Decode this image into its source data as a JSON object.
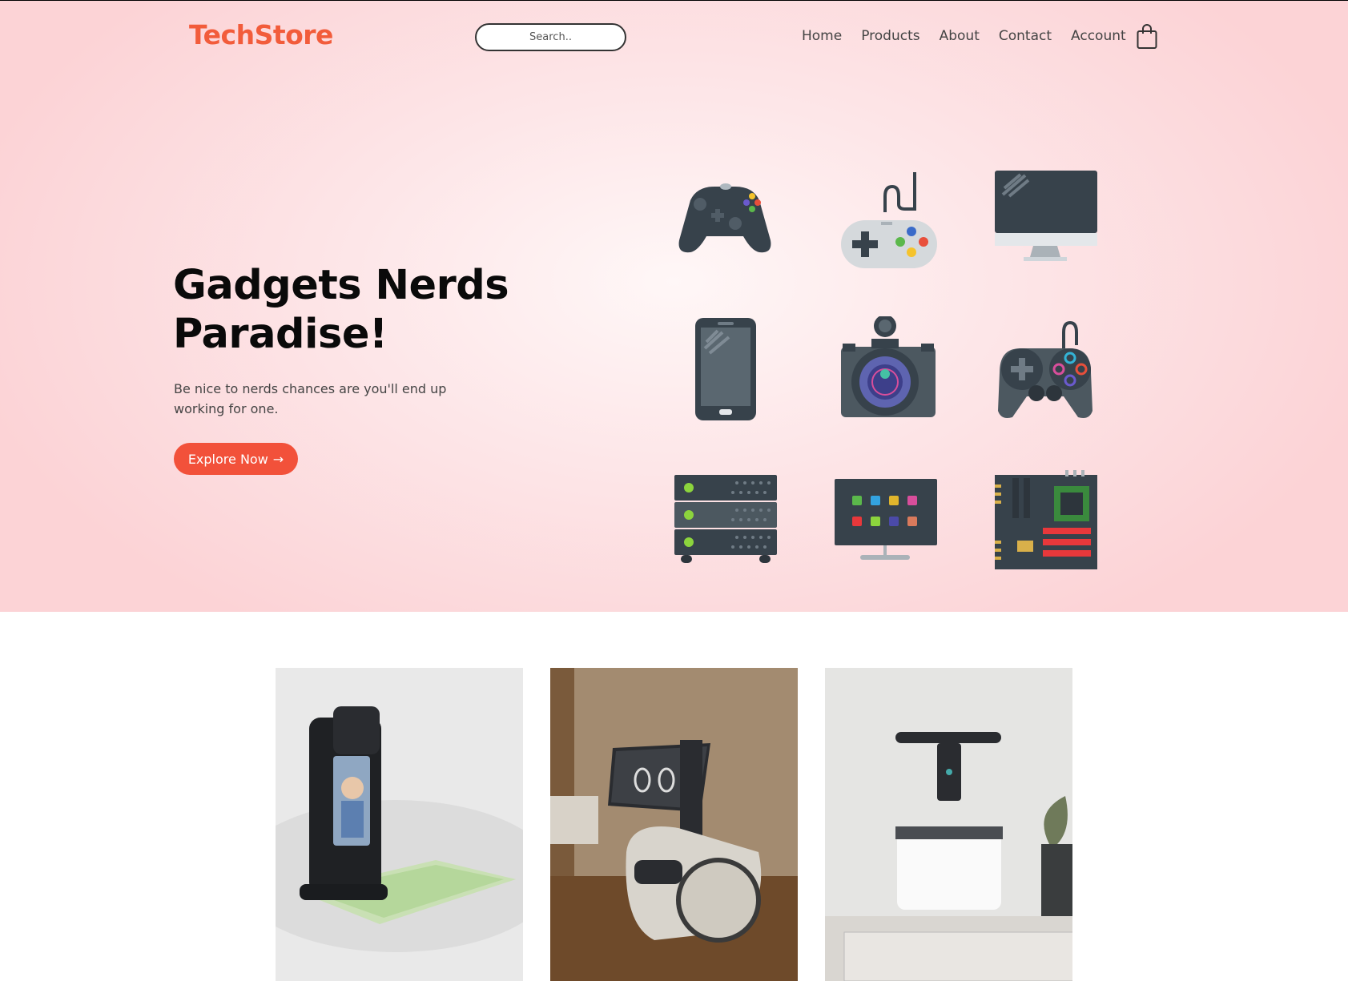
{
  "brand": {
    "name": "TechStore",
    "accent": "#f25c3b"
  },
  "search": {
    "placeholder": "Search.."
  },
  "nav": {
    "items": [
      {
        "label": "Home"
      },
      {
        "label": "Products"
      },
      {
        "label": "About"
      },
      {
        "label": "Contact"
      },
      {
        "label": "Account"
      }
    ],
    "cart_icon": "shopping-bag-icon"
  },
  "hero": {
    "title_line1": "Gadgets Nerds",
    "title_line2": "Paradise!",
    "subtitle": "Be nice to nerds chances are you'll end up working for one.",
    "cta_label": "Explore Now",
    "cta_arrow": "→",
    "icons": [
      "xbox-controller-icon",
      "retro-gamepad-icon",
      "desktop-monitor-icon",
      "smartphone-icon",
      "camera-icon",
      "gamepad-icon",
      "server-rack-icon",
      "smart-tv-icon",
      "motherboard-icon"
    ]
  },
  "products": [
    {
      "icon": "video-projector-device-image"
    },
    {
      "icon": "home-robot-image"
    },
    {
      "icon": "security-drone-image"
    }
  ]
}
